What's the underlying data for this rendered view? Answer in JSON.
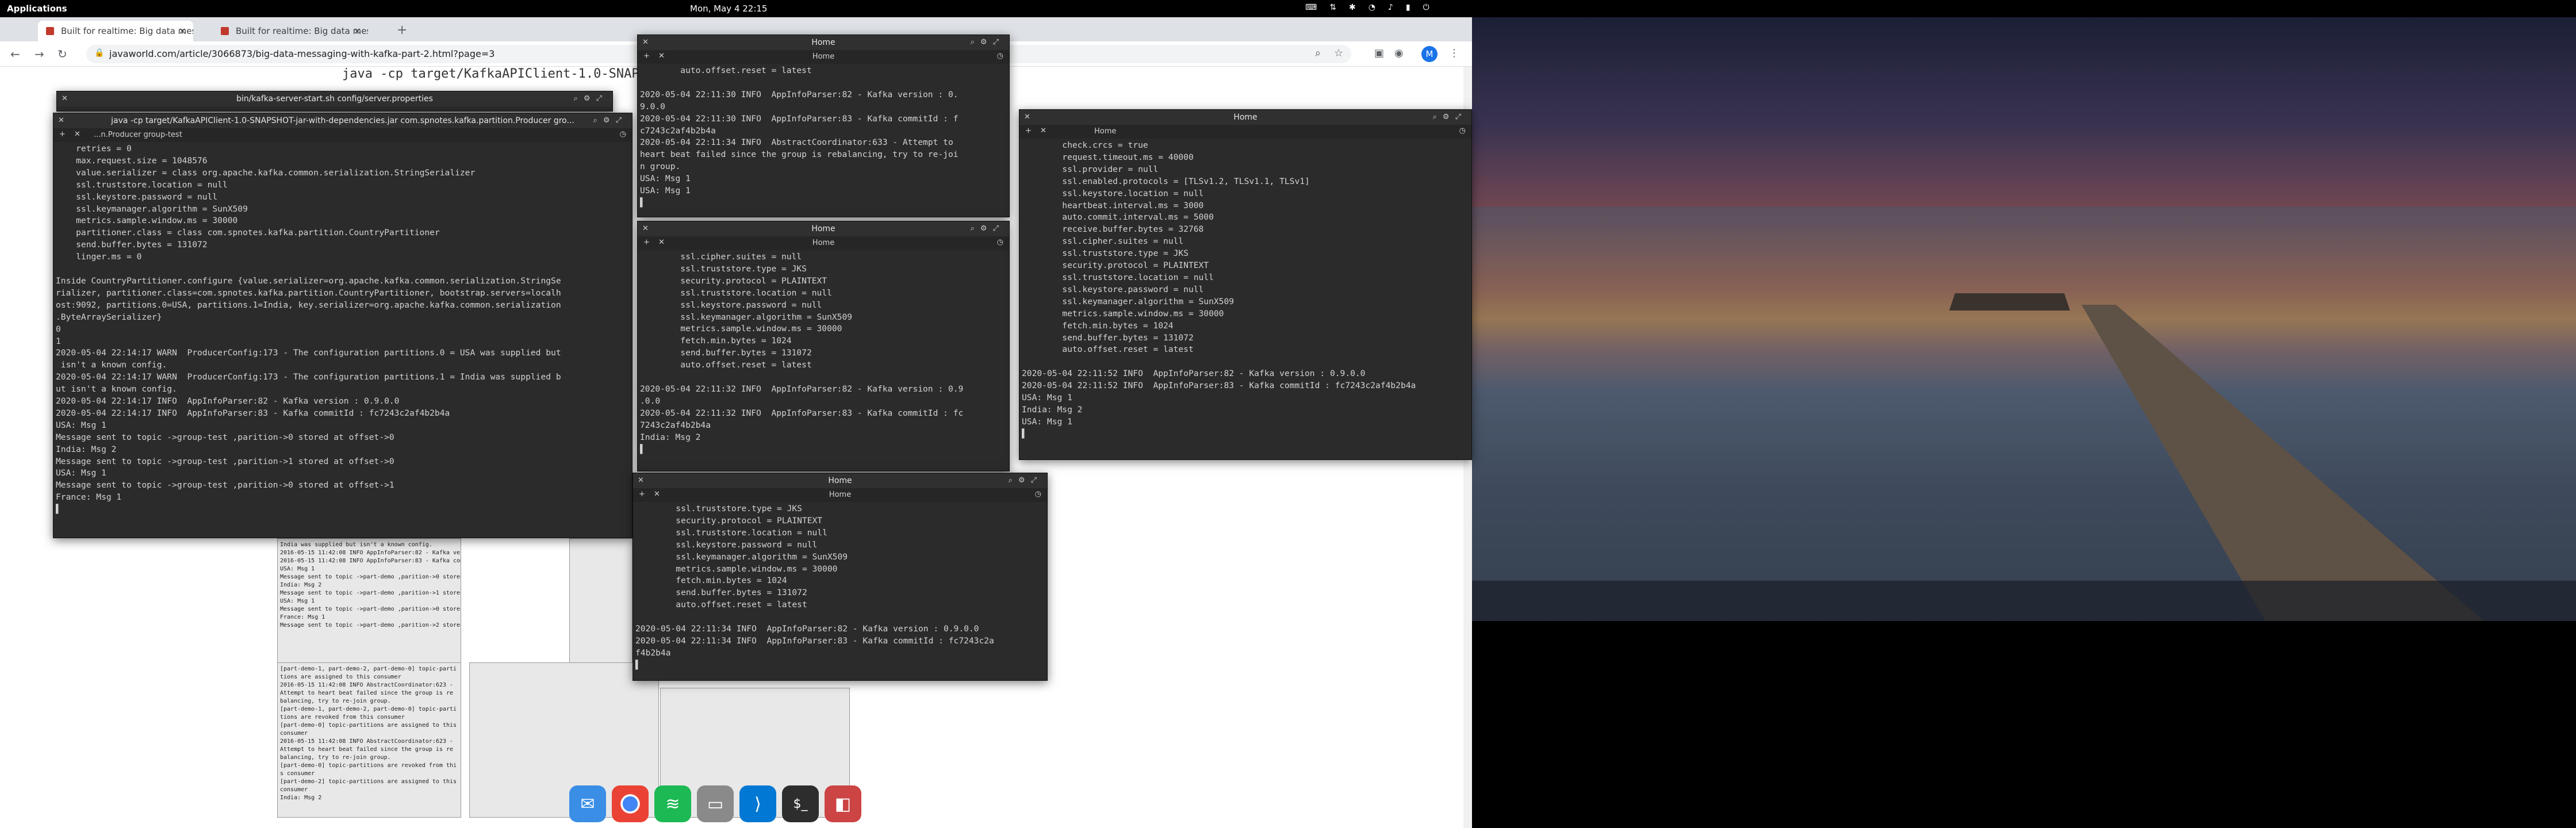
{
  "topbar": {
    "applications": "Applications",
    "clock": "Mon, May 4   22:15"
  },
  "browser": {
    "tabs": [
      {
        "label": "Built for realtime: Big data mes"
      },
      {
        "label": "Built for realtime: Big data mes"
      }
    ],
    "url": "javaworld.com/article/3066873/big-data-messaging-with-kafka-part-2.html?page=3",
    "page_code": "java -cp target/KafkaAPIClient-1.0-SNAPSHOT...",
    "avatar_letter": "M"
  },
  "terminals": {
    "server": {
      "title": "bin/kafka-server-start.sh config/server.properties"
    },
    "producer": {
      "title": "java -cp target/KafkaAPIClient-1.0-SNAPSHOT-jar-with-dependencies.jar com.spnotes.kafka.partition.Producer gro...",
      "tab": "...n.Producer group-test",
      "content": "    retries = 0\n    max.request.size = 1048576\n    value.serializer = class org.apache.kafka.common.serialization.StringSerializer\n    ssl.truststore.location = null\n    ssl.keystore.password = null\n    ssl.keymanager.algorithm = SunX509\n    metrics.sample.window.ms = 30000\n    partitioner.class = class com.spnotes.kafka.partition.CountryPartitioner\n    send.buffer.bytes = 131072\n    linger.ms = 0\n\nInside CountryPartitioner.configure {value.serializer=org.apache.kafka.common.serialization.StringSe\nrializer, partitioner.class=com.spnotes.kafka.partition.CountryPartitioner, bootstrap.servers=localh\nost:9092, partitions.0=USA, partitions.1=India, key.serializer=org.apache.kafka.common.serialization\n.ByteArraySerializer}\n0\n1\n2020-05-04 22:14:17 WARN  ProducerConfig:173 - The configuration partitions.0 = USA was supplied but\n isn't a known config.\n2020-05-04 22:14:17 WARN  ProducerConfig:173 - The configuration partitions.1 = India was supplied b\nut isn't a known config.\n2020-05-04 22:14:17 INFO  AppInfoParser:82 - Kafka version : 0.9.0.0\n2020-05-04 22:14:17 INFO  AppInfoParser:83 - Kafka commitId : fc7243c2af4b2b4a\nUSA: Msg 1\nMessage sent to topic ->group-test ,parition->0 stored at offset->0\nIndia: Msg 2\nMessage sent to topic ->group-test ,parition->1 stored at offset->0\nUSA: Msg 1\nMessage sent to topic ->group-test ,parition->0 stored at offset->1\nFrance: Msg 1\n▌"
    },
    "consumer1": {
      "title": "Home",
      "tab": "Home",
      "content": "        auto.offset.reset = latest\n\n2020-05-04 22:11:30 INFO  AppInfoParser:82 - Kafka version : 0.\n9.0.0\n2020-05-04 22:11:30 INFO  AppInfoParser:83 - Kafka commitId : f\nc7243c2af4b2b4a\n2020-05-04 22:11:34 INFO  AbstractCoordinator:633 - Attempt to\nheart beat failed since the group is rebalancing, try to re-joi\nn group.\nUSA: Msg 1\nUSA: Msg 1\n▌"
    },
    "consumer2": {
      "title": "Home",
      "tab": "Home",
      "content": "        ssl.cipher.suites = null\n        ssl.truststore.type = JKS\n        security.protocol = PLAINTEXT\n        ssl.truststore.location = null\n        ssl.keystore.password = null\n        ssl.keymanager.algorithm = SunX509\n        metrics.sample.window.ms = 30000\n        fetch.min.bytes = 1024\n        send.buffer.bytes = 131072\n        auto.offset.reset = latest\n\n2020-05-04 22:11:32 INFO  AppInfoParser:82 - Kafka version : 0.9\n.0.0\n2020-05-04 22:11:32 INFO  AppInfoParser:83 - Kafka commitId : fc\n7243c2af4b2b4a\nIndia: Msg 2\n▌"
    },
    "consumer3": {
      "title": "Home",
      "tab": "Home",
      "content": "        ssl.truststore.type = JKS\n        security.protocol = PLAINTEXT\n        ssl.truststore.location = null\n        ssl.keystore.password = null\n        ssl.keymanager.algorithm = SunX509\n        metrics.sample.window.ms = 30000\n        fetch.min.bytes = 1024\n        send.buffer.bytes = 131072\n        auto.offset.reset = latest\n\n2020-05-04 22:11:34 INFO  AppInfoParser:82 - Kafka version : 0.9.0.0\n2020-05-04 22:11:34 INFO  AppInfoParser:83 - Kafka commitId : fc7243c2a\nf4b2b4a\n▌"
    },
    "consumer4": {
      "title": "Home",
      "tab": "Home",
      "content": "        check.crcs = true\n        request.timeout.ms = 40000\n        ssl.provider = null\n        ssl.enabled.protocols = [TLSv1.2, TLSv1.1, TLSv1]\n        ssl.keystore.location = null\n        heartbeat.interval.ms = 3000\n        auto.commit.interval.ms = 5000\n        receive.buffer.bytes = 32768\n        ssl.cipher.suites = null\n        ssl.truststore.type = JKS\n        security.protocol = PLAINTEXT\n        ssl.truststore.location = null\n        ssl.keystore.password = null\n        ssl.keymanager.algorithm = SunX509\n        metrics.sample.window.ms = 30000\n        fetch.min.bytes = 1024\n        send.buffer.bytes = 131072\n        auto.offset.reset = latest\n\n2020-05-04 22:11:52 INFO  AppInfoParser:82 - Kafka version : 0.9.0.0\n2020-05-04 22:11:52 INFO  AppInfoParser:83 - Kafka commitId : fc7243c2af4b2b4a\nUSA: Msg 1\nIndia: Msg 2\nUSA: Msg 1\n▌"
    }
  },
  "article_thumb": {
    "left": "India was supplied but isn't a known config.\n2016-05-15 11:42:08 INFO AppInfoParser:82 - Kafka version : 0.9.0.0\n2016-05-15 11:42:08 INFO AppInfoParser:83 - Kafka commitId : fc7243c2af4b2b4a\nUSA: Msg 1\nMessage sent to topic ->part-demo ,parition->0 stored at offset->6\nIndia: Msg 2\nMessage sent to topic ->part-demo ,parition->1 stored at offset->4\nUSA: Msg 1\nMessage sent to topic ->part-demo ,parition->0 stored at offset->7\nFrance: Msg 1\nMessage sent to topic ->part-demo ,parition->2 stored at offset->3",
    "bottom": "[part-demo-1, part-demo-2, part-demo-0] topic-parti\ntions are assigned to this consumer\n2016-05-15 11:42:08 INFO AbstractCoordinator:623 -\nAttempt to heart beat failed since the group is re\nbalancing, try to re-join group.\n[part-demo-1, part-demo-2, part-demo-0] topic-parti\ntions are revoked from this consumer\n[part-demo-0] topic-partitions are assigned to this\nconsumer\n2016-05-15 11:42:08 INFO AbstractCoordinator:623 -\nAttempt to heart beat failed since the group is re\nbalancing, try to re-join group.\n[part-demo-0] topic-partitions are revoked from thi\ns consumer\n[part-demo-2] topic-partitions are assigned to this\nconsumer\nIndia: Msg 2"
  },
  "dock": [
    {
      "name": "mail"
    },
    {
      "name": "chrome"
    },
    {
      "name": "spotify"
    },
    {
      "name": "files"
    },
    {
      "name": "vscode"
    },
    {
      "name": "terminal"
    },
    {
      "name": "software"
    }
  ]
}
